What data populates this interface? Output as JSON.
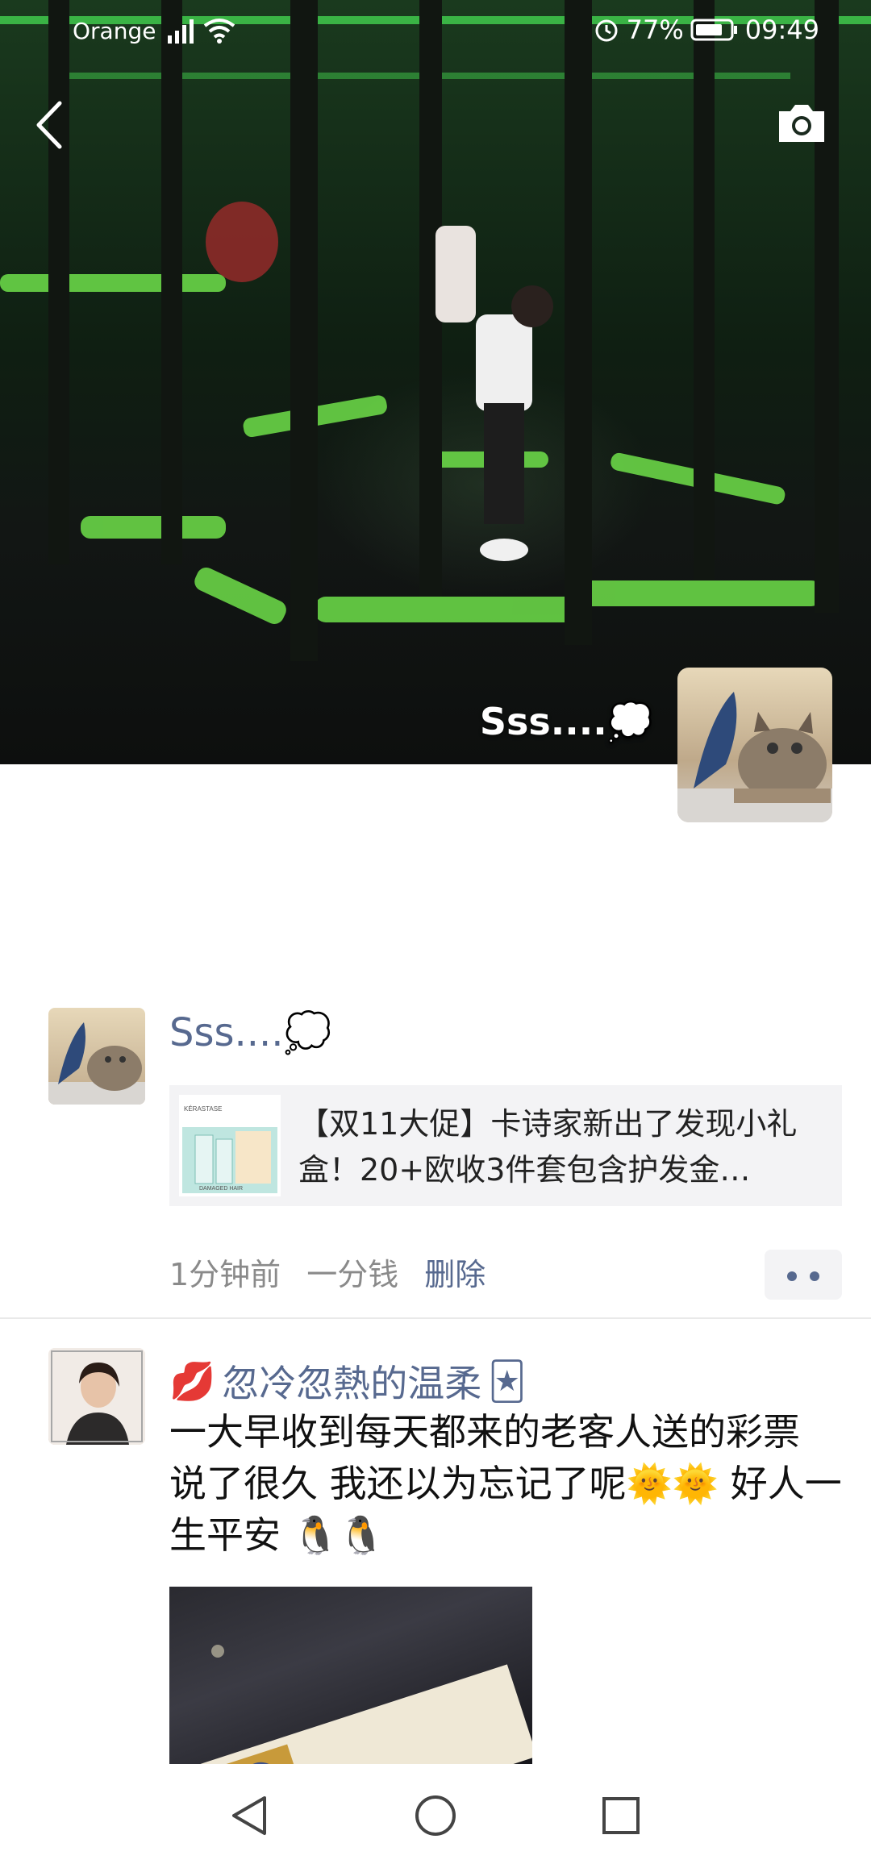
{
  "status_bar": {
    "carrier": "Orange",
    "battery": "77%",
    "time": "09:49"
  },
  "cover": {
    "profile_name": "Sss....",
    "profile_name_emoji": "thought-balloon-icon"
  },
  "post1": {
    "author": "Sss....",
    "share_title": "【双11大促】卡诗家新出了发现小礼盒！20+欧收3件套包含护发金…",
    "thumb_brand": "KÉRASTASE",
    "thumb_caption": "DAMAGED HAIR",
    "time": "1分钟前",
    "extra": "一分钱",
    "delete_label": "删除"
  },
  "post2": {
    "author": "忽冷忽熱的温柔",
    "text": "一大早收到每天都来的老客人送的彩票 说了很久 我还以为忘记了呢🌞🌞 好人一生平安 🐧🐧"
  },
  "icons": [
    "back-icon",
    "camera-icon",
    "nav-back-icon",
    "nav-home-icon",
    "nav-recents-icon"
  ]
}
